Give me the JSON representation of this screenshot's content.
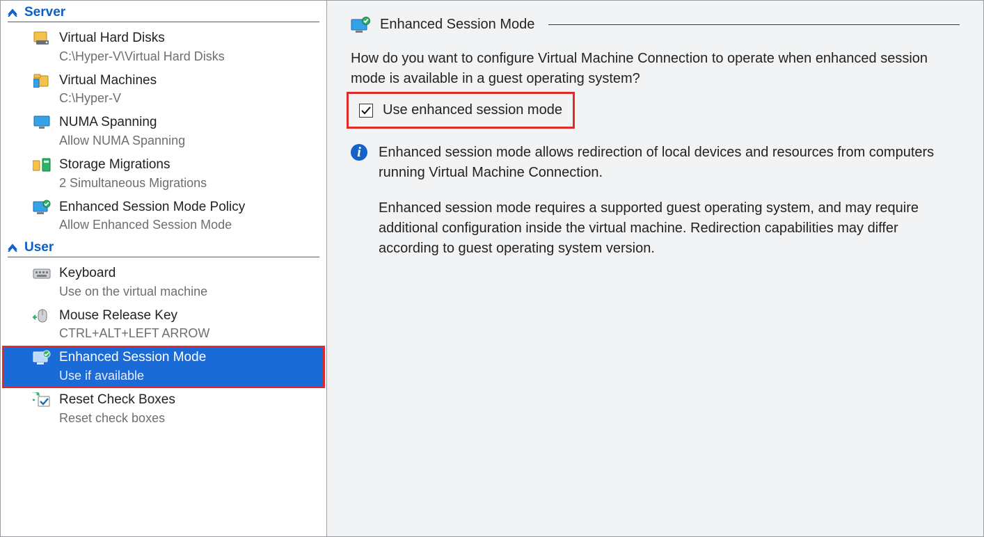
{
  "nav": {
    "sections": [
      {
        "id": "server",
        "label": "Server",
        "items": [
          {
            "id": "vhd",
            "label": "Virtual Hard Disks",
            "sub": "C:\\Hyper-V\\Virtual Hard Disks"
          },
          {
            "id": "vm",
            "label": "Virtual Machines",
            "sub": "C:\\Hyper-V"
          },
          {
            "id": "numa",
            "label": "NUMA Spanning",
            "sub": "Allow NUMA Spanning"
          },
          {
            "id": "stor",
            "label": "Storage Migrations",
            "sub": "2 Simultaneous Migrations"
          },
          {
            "id": "esmp",
            "label": "Enhanced Session Mode Policy",
            "sub": "Allow Enhanced Session Mode"
          }
        ]
      },
      {
        "id": "user",
        "label": "User",
        "items": [
          {
            "id": "kb",
            "label": "Keyboard",
            "sub": "Use on the virtual machine"
          },
          {
            "id": "mrk",
            "label": "Mouse Release Key",
            "sub": "CTRL+ALT+LEFT ARROW"
          },
          {
            "id": "esm",
            "label": "Enhanced Session Mode",
            "sub": "Use if available",
            "selected": true,
            "highlight": true
          },
          {
            "id": "reset",
            "label": "Reset Check Boxes",
            "sub": "Reset check boxes"
          }
        ]
      }
    ]
  },
  "content": {
    "title": "Enhanced Session Mode",
    "intro": "How do you want to configure Virtual Machine Connection to operate when enhanced session mode is available in a guest operating system?",
    "checkbox": {
      "label": "Use enhanced session mode",
      "checked": true,
      "highlight": true
    },
    "info": {
      "p1": "Enhanced session mode allows redirection of local devices and resources from computers running Virtual Machine Connection.",
      "p2": "Enhanced session mode requires a supported guest operating system, and may require additional configuration inside the virtual machine. Redirection capabilities may differ according to guest operating system version."
    }
  }
}
